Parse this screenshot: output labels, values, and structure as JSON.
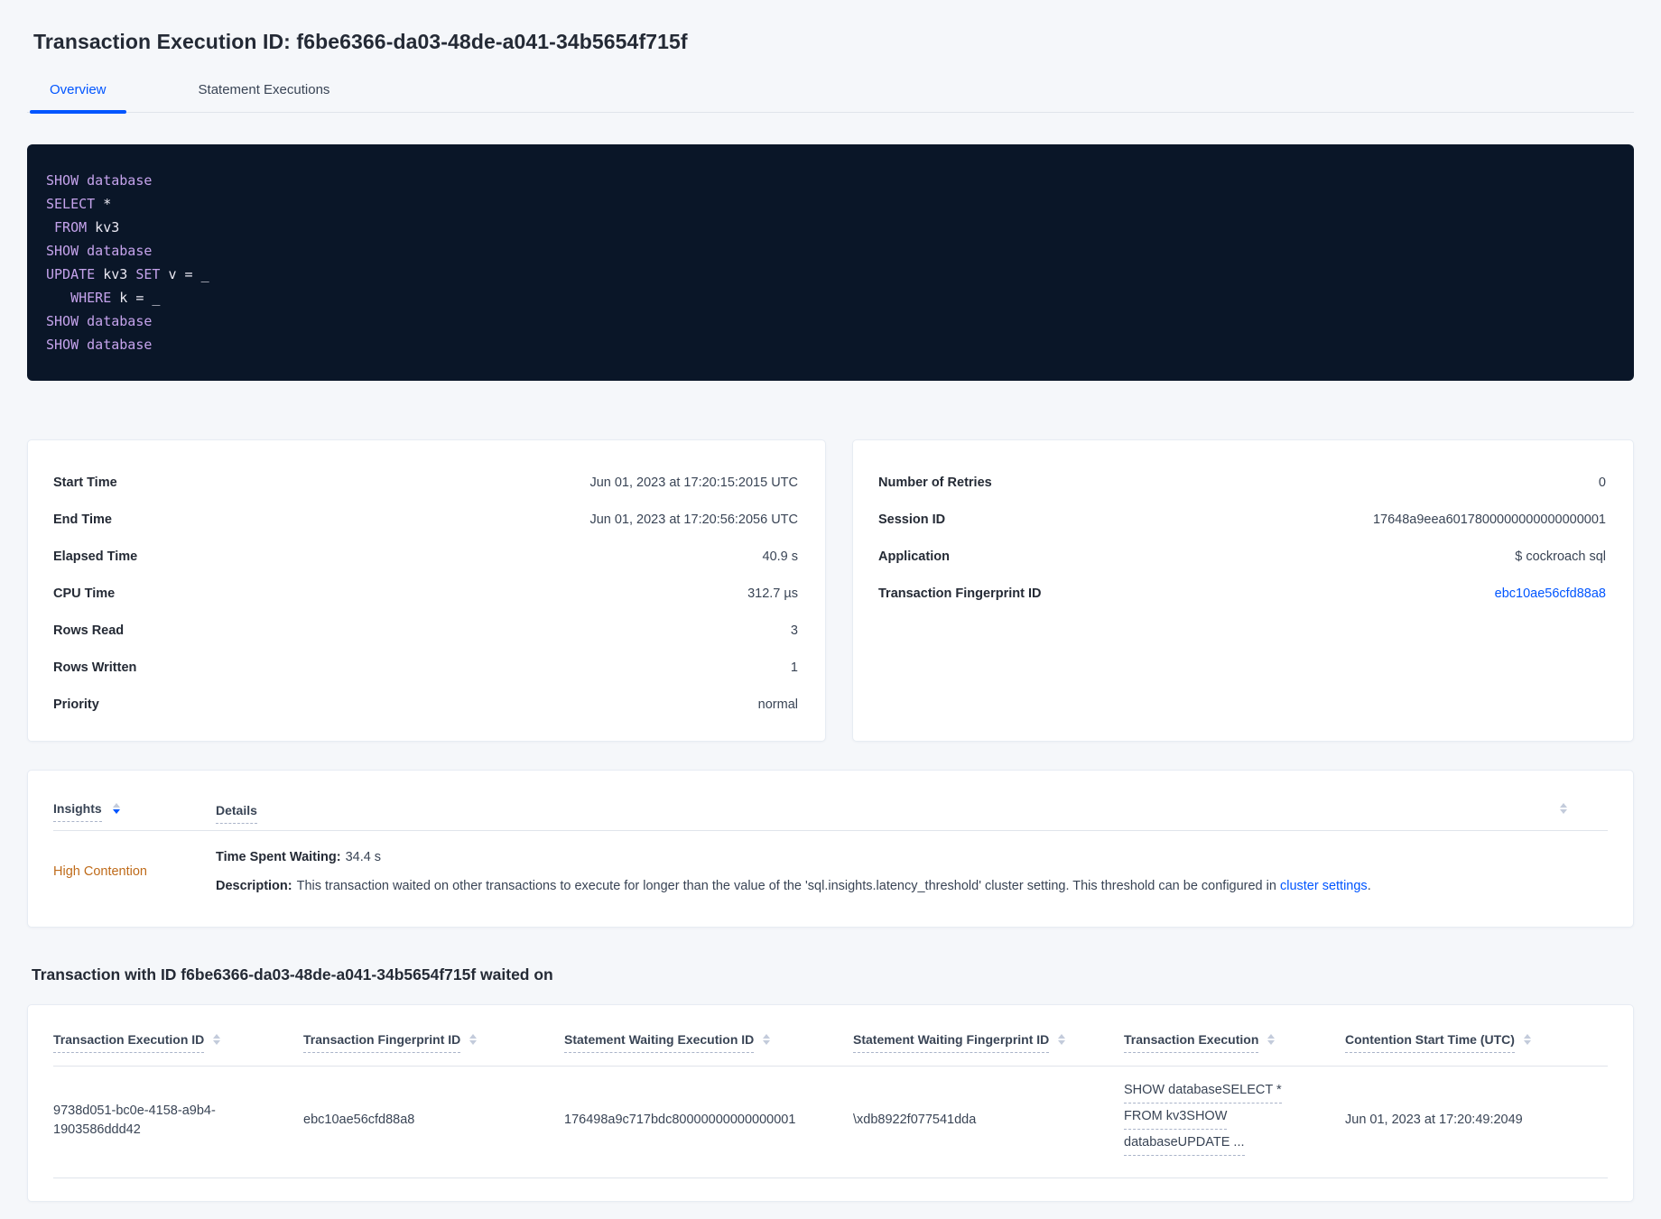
{
  "page": {
    "title": "Transaction Execution ID: f6be6366-da03-48de-a041-34b5654f715f",
    "section_title": "Transaction with ID f6be6366-da03-48de-a041-34b5654f715f waited on"
  },
  "colors": {
    "accent_blue": "#0055ff",
    "insight_orange": "#bf6b1a",
    "code_background": "#0a1628",
    "code_keyword": "#c5a3ec",
    "code_plain": "#eceaf4"
  },
  "tabs": [
    {
      "label": "Overview",
      "active": true
    },
    {
      "label": "Statement Executions",
      "active": false
    }
  ],
  "sql": {
    "lines": [
      [
        {
          "t": "SHOW database",
          "c": "k"
        }
      ],
      [
        {
          "t": "SELECT",
          "c": "k"
        },
        {
          "t": " *",
          "c": "p"
        }
      ],
      [
        {
          "t": " ",
          "c": "p"
        },
        {
          "t": "FROM",
          "c": "k"
        },
        {
          "t": " kv3",
          "c": "p"
        }
      ],
      [
        {
          "t": "SHOW database",
          "c": "k"
        }
      ],
      [
        {
          "t": "UPDATE",
          "c": "k"
        },
        {
          "t": " kv3 ",
          "c": "p"
        },
        {
          "t": "SET",
          "c": "k"
        },
        {
          "t": " v = _",
          "c": "p"
        }
      ],
      [
        {
          "t": "   ",
          "c": "p"
        },
        {
          "t": "WHERE",
          "c": "k"
        },
        {
          "t": " k = _",
          "c": "p"
        }
      ],
      [
        {
          "t": "SHOW database",
          "c": "k"
        }
      ],
      [
        {
          "t": "SHOW database",
          "c": "k"
        }
      ]
    ]
  },
  "summary_left": {
    "rows": [
      {
        "label": "Start Time",
        "value": "Jun 01, 2023 at 17:20:15:2015 UTC"
      },
      {
        "label": "End Time",
        "value": "Jun 01, 2023 at 17:20:56:2056 UTC"
      },
      {
        "label": "Elapsed Time",
        "value": "40.9 s"
      },
      {
        "label": "CPU Time",
        "value": "312.7 µs"
      },
      {
        "label": "Rows Read",
        "value": "3"
      },
      {
        "label": "Rows Written",
        "value": "1"
      },
      {
        "label": "Priority",
        "value": "normal"
      }
    ]
  },
  "summary_right": {
    "rows": [
      {
        "label": "Number of Retries",
        "value": "0"
      },
      {
        "label": "Session ID",
        "value": "17648a9eea6017800000000000000001"
      },
      {
        "label": "Application",
        "value": "$ cockroach sql"
      },
      {
        "label": "Transaction Fingerprint ID",
        "value": "ebc10ae56cfd88a8",
        "link": true
      }
    ]
  },
  "insights": {
    "columns": [
      {
        "label": "Insights",
        "sort": "desc"
      },
      {
        "label": "Details"
      }
    ],
    "row": {
      "insight": "High Contention",
      "waiting_label": "Time Spent Waiting:",
      "waiting_value": "34.4 s",
      "description_label": "Description:",
      "description_text": "This transaction waited on other transactions to execute for longer than the value of the 'sql.insights.latency_threshold' cluster setting. This threshold can be configured in",
      "description_link": "cluster settings",
      "description_suffix": "."
    }
  },
  "waited_table": {
    "columns": [
      "Transaction Execution ID",
      "Transaction Fingerprint ID",
      "Statement Waiting Execution ID",
      "Statement Waiting Fingerprint ID",
      "Transaction Execution",
      "Contention Start Time (UTC)"
    ],
    "rows": [
      {
        "cells": [
          {
            "lines": [
              "9738d051-bc0e-4158-a9b4-",
              "1903586ddd42"
            ]
          },
          {
            "lines": [
              "ebc10ae56cfd88a8"
            ]
          },
          {
            "lines": [
              "176498a9c717bdc80000000000000001"
            ]
          },
          {
            "lines": [
              "\\xdb8922f077541dda"
            ]
          },
          {
            "lines": [
              "SHOW databaseSELECT *",
              "FROM kv3SHOW",
              "databaseUPDATE ..."
            ],
            "style": "dashed"
          },
          {
            "lines": [
              "Jun 01, 2023 at 17:20:49:2049"
            ]
          }
        ]
      }
    ]
  }
}
